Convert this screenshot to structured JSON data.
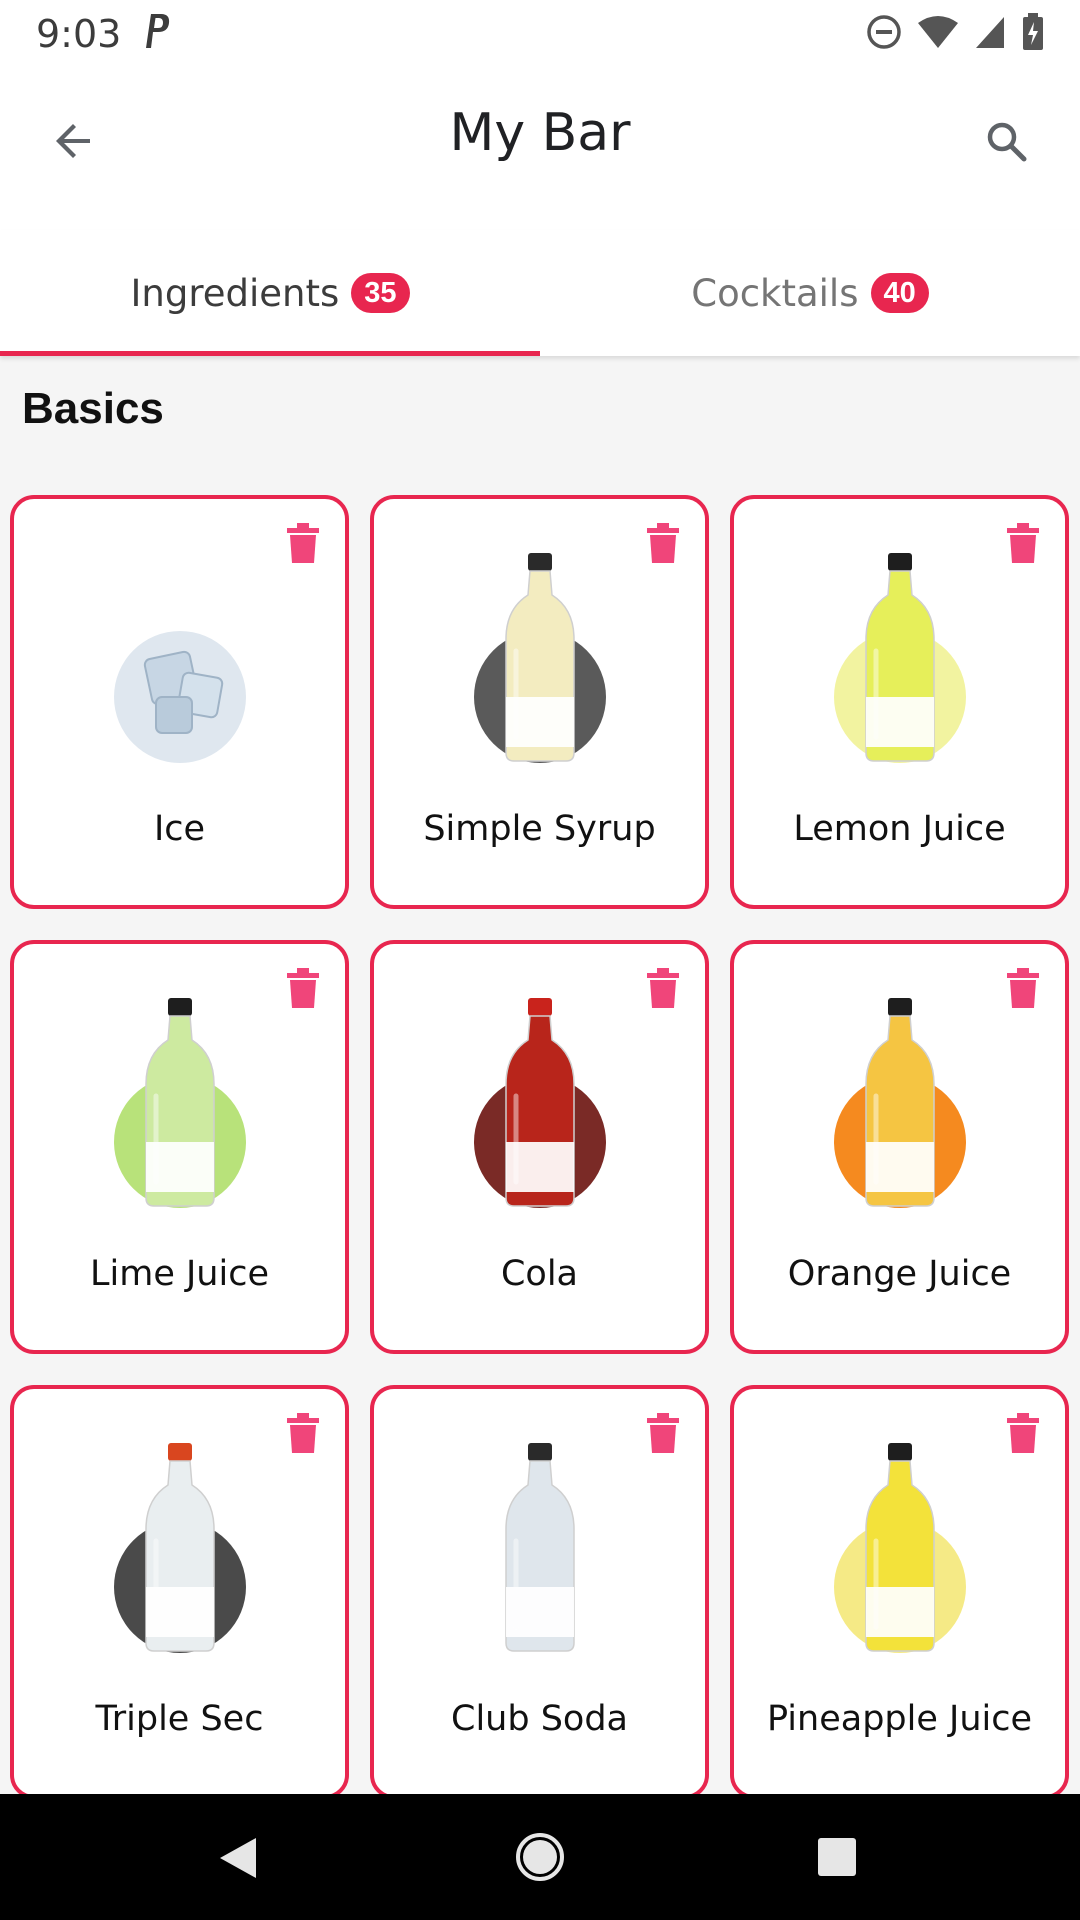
{
  "status_bar": {
    "time": "9:03"
  },
  "app_bar": {
    "title": "My Bar"
  },
  "tabs": [
    {
      "label": "Ingredients",
      "count": "35"
    },
    {
      "label": "Cocktails",
      "count": "40"
    }
  ],
  "section": {
    "title": "Basics"
  },
  "ingredients": [
    {
      "name": "Ice",
      "circle": "#dfe7ef",
      "liquid": "#e7eef5",
      "cap": "#cfd8e0",
      "kind": "ice"
    },
    {
      "name": "Simple Syrup",
      "circle": "#5a5a5a",
      "liquid": "#f3ecc0",
      "cap": "#2a2a2a",
      "kind": "bottle"
    },
    {
      "name": "Lemon Juice",
      "circle": "#f2f3a0",
      "liquid": "#e6ef5a",
      "cap": "#1e1e1e",
      "kind": "bottle"
    },
    {
      "name": "Lime Juice",
      "circle": "#b8e27a",
      "liquid": "#cdeaa0",
      "cap": "#1e1e1e",
      "kind": "bottle"
    },
    {
      "name": "Cola",
      "circle": "#7a2a26",
      "liquid": "#b8251b",
      "cap": "#c9231c",
      "kind": "bottle"
    },
    {
      "name": "Orange Juice",
      "circle": "#f58a1f",
      "liquid": "#f5c542",
      "cap": "#1e1e1e",
      "kind": "bottle"
    },
    {
      "name": "Triple Sec",
      "circle": "#4a4a4a",
      "liquid": "#e9eef0",
      "cap": "#d9461f",
      "kind": "bottle"
    },
    {
      "name": "Club Soda",
      "circle": "#ffffff",
      "liquid": "#dfe6ec",
      "cap": "#2a2a2a",
      "kind": "bottle"
    },
    {
      "name": "Pineapple Juice",
      "circle": "#f5ea86",
      "liquid": "#f3e23a",
      "cap": "#1e1e1e",
      "kind": "bottle"
    }
  ],
  "colors": {
    "accent": "#e8264f",
    "trash": "#f0457a"
  },
  "icons": {
    "back": "arrow-back-icon",
    "search": "search-icon",
    "delete": "trash-icon",
    "nav_back": "triangle-back-icon",
    "nav_home": "circle-home-icon",
    "nav_recent": "square-recent-icon"
  }
}
